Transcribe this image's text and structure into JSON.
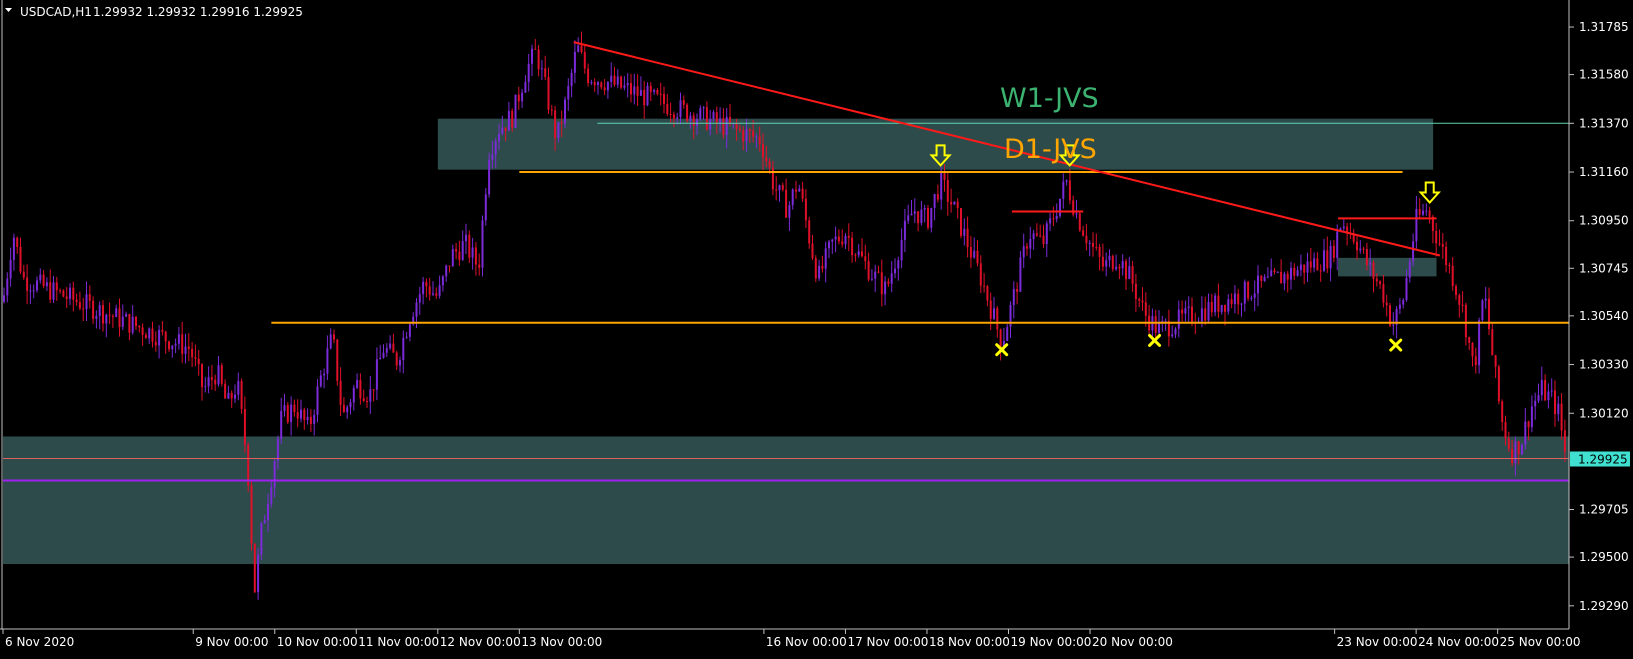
{
  "header": {
    "symbol_label": "USDCAD,H1",
    "ohlc_text": "1.29932 1.29932 1.29916 1.29925"
  },
  "colors": {
    "background": "#000000",
    "axis": "#c0c0c0",
    "bull_candle": "#7b2bd9",
    "bear_candle": "#e0102a",
    "zone_fill": "#2f4f4f",
    "orange_line": "#ffa500",
    "trend_line": "#ff1a1a",
    "w1_line": "#5fd3b0",
    "purple_line": "#a020f0",
    "marker": "#ffff00",
    "price_box": "#40e0d0"
  },
  "annotations": {
    "w1_label": "W1-JVS",
    "d1_label": "D1-JVS"
  },
  "chart_data": {
    "type": "candlestick",
    "symbol": "USDCAD",
    "timeframe": "H1",
    "ylim": [
      1.2919,
      1.3188
    ],
    "xlim": [
      "2020-11-06T16:00",
      "2020-11-25T21:00"
    ],
    "y_ticks": [
      "1.31785",
      "1.31580",
      "1.31370",
      "1.31160",
      "1.30950",
      "1.30745",
      "1.30540",
      "1.30330",
      "1.30120",
      "1.29705",
      "1.29500",
      "1.29290"
    ],
    "x_ticks": [
      {
        "label": "6 Nov 2020",
        "t": "2020-11-06T16:00"
      },
      {
        "label": "9 Nov 00:00",
        "t": "2020-11-09T00:00"
      },
      {
        "label": "10 Nov 00:00",
        "t": "2020-11-10T00:00"
      },
      {
        "label": "11 Nov 00:00",
        "t": "2020-11-11T00:00"
      },
      {
        "label": "12 Nov 00:00",
        "t": "2020-11-12T00:00"
      },
      {
        "label": "13 Nov 00:00",
        "t": "2020-11-13T00:00"
      },
      {
        "label": "16 Nov 00:00",
        "t": "2020-11-16T00:00"
      },
      {
        "label": "17 Nov 00:00",
        "t": "2020-11-17T00:00"
      },
      {
        "label": "18 Nov 00:00",
        "t": "2020-11-18T00:00"
      },
      {
        "label": "19 Nov 00:00",
        "t": "2020-11-19T00:00"
      },
      {
        "label": "20 Nov 00:00",
        "t": "2020-11-20T00:00"
      },
      {
        "label": "23 Nov 00:00",
        "t": "2020-11-23T00:00"
      },
      {
        "label": "24 Nov 00:00",
        "t": "2020-11-24T00:00"
      },
      {
        "label": "25 Nov 00:00",
        "t": "2020-11-25T00:00"
      }
    ],
    "current_price": "1.29925",
    "price_path": [
      [
        "2020-11-06T16:00",
        1.306
      ],
      [
        "2020-11-06T19:00",
        1.309
      ],
      [
        "2020-11-06T22:00",
        1.307
      ],
      [
        "2020-11-08T23:00",
        1.304
      ],
      [
        "2020-11-09T03:00",
        1.3022
      ],
      [
        "2020-11-09T07:00",
        1.303
      ],
      [
        "2020-11-09T10:00",
        1.3015
      ],
      [
        "2020-11-09T13:00",
        1.3025
      ],
      [
        "2020-11-09T16:00",
        1.299
      ],
      [
        "2020-11-09T18:00",
        1.2935
      ],
      [
        "2020-11-09T20:00",
        1.296
      ],
      [
        "2020-11-09T23:00",
        1.2985
      ],
      [
        "2020-11-10T02:00",
        1.301
      ],
      [
        "2020-11-10T06:00",
        1.3015
      ],
      [
        "2020-11-10T10:00",
        1.3005
      ],
      [
        "2020-11-10T14:00",
        1.303
      ],
      [
        "2020-11-10T17:00",
        1.3045
      ],
      [
        "2020-11-10T20:00",
        1.301
      ],
      [
        "2020-11-11T00:00",
        1.3025
      ],
      [
        "2020-11-11T04:00",
        1.302
      ],
      [
        "2020-11-11T08:00",
        1.304
      ],
      [
        "2020-11-11T12:00",
        1.3035
      ],
      [
        "2020-11-11T16:00",
        1.3055
      ],
      [
        "2020-11-11T20:00",
        1.3068
      ],
      [
        "2020-11-12T00:00",
        1.3062
      ],
      [
        "2020-11-12T04:00",
        1.308
      ],
      [
        "2020-11-12T08:00",
        1.3085
      ],
      [
        "2020-11-12T12:00",
        1.3075
      ],
      [
        "2020-11-12T15:00",
        1.3125
      ],
      [
        "2020-11-12T18:00",
        1.3135
      ],
      [
        "2020-11-12T22:00",
        1.314
      ],
      [
        "2020-11-13T02:00",
        1.316
      ],
      [
        "2020-11-13T05:00",
        1.3168
      ],
      [
        "2020-11-13T08:00",
        1.315
      ],
      [
        "2020-11-13T11:00",
        1.313
      ],
      [
        "2020-11-13T14:00",
        1.3148
      ],
      [
        "2020-11-13T17:00",
        1.317
      ],
      [
        "2020-11-13T20:00",
        1.3158
      ],
      [
        "2020-11-15T23:00",
        1.313
      ],
      [
        "2020-11-16T03:00",
        1.311
      ],
      [
        "2020-11-16T07:00",
        1.31
      ],
      [
        "2020-11-16T10:00",
        1.3112
      ],
      [
        "2020-11-16T13:00",
        1.309
      ],
      [
        "2020-11-16T16:00",
        1.307
      ],
      [
        "2020-11-16T20:00",
        1.3085
      ],
      [
        "2020-11-17T00:00",
        1.309
      ],
      [
        "2020-11-17T04:00",
        1.308
      ],
      [
        "2020-11-17T08:00",
        1.3072
      ],
      [
        "2020-11-17T12:00",
        1.3065
      ],
      [
        "2020-11-17T16:00",
        1.3085
      ],
      [
        "2020-11-17T20:00",
        1.31
      ],
      [
        "2020-11-18T00:00",
        1.3095
      ],
      [
        "2020-11-18T04:00",
        1.3112
      ],
      [
        "2020-11-18T08:00",
        1.31
      ],
      [
        "2020-11-18T12:00",
        1.3085
      ],
      [
        "2020-11-18T16:00",
        1.307
      ],
      [
        "2020-11-18T20:00",
        1.3052
      ],
      [
        "2020-11-18T22:00",
        1.3042
      ],
      [
        "2020-11-19T02:00",
        1.3065
      ],
      [
        "2020-11-19T06:00",
        1.309
      ],
      [
        "2020-11-19T10:00",
        1.3085
      ],
      [
        "2020-11-19T14:00",
        1.31
      ],
      [
        "2020-11-19T17:00",
        1.3112
      ],
      [
        "2020-11-19T20:00",
        1.3098
      ],
      [
        "2020-11-20T00:00",
        1.3085
      ],
      [
        "2020-11-20T04:00",
        1.3075
      ],
      [
        "2020-11-20T08:00",
        1.308
      ],
      [
        "2020-11-20T12:00",
        1.307
      ],
      [
        "2020-11-20T16:00",
        1.3055
      ],
      [
        "2020-11-20T20:00",
        1.3048
      ],
      [
        "2020-11-22T23:00",
        1.308
      ],
      [
        "2020-11-23T02:00",
        1.3095
      ],
      [
        "2020-11-23T06:00",
        1.3088
      ],
      [
        "2020-11-23T10:00",
        1.3075
      ],
      [
        "2020-11-23T14:00",
        1.3065
      ],
      [
        "2020-11-23T17:00",
        1.305
      ],
      [
        "2020-11-23T20:00",
        1.306
      ],
      [
        "2020-11-24T00:00",
        1.3095
      ],
      [
        "2020-11-24T03:00",
        1.31
      ],
      [
        "2020-11-24T07:00",
        1.3085
      ],
      [
        "2020-11-24T11:00",
        1.307
      ],
      [
        "2020-11-24T14:00",
        1.3055
      ],
      [
        "2020-11-24T17:00",
        1.303
      ],
      [
        "2020-11-24T20:00",
        1.3065
      ],
      [
        "2020-11-24T22:00",
        1.3042
      ],
      [
        "2020-11-25T01:00",
        1.301
      ],
      [
        "2020-11-25T04:00",
        1.2995
      ],
      [
        "2020-11-25T07:00",
        1.3
      ],
      [
        "2020-11-25T10:00",
        1.3015
      ],
      [
        "2020-11-25T13:00",
        1.3022
      ],
      [
        "2020-11-25T16:00",
        1.3018
      ],
      [
        "2020-11-25T18:00",
        1.3012
      ],
      [
        "2020-11-25T20:00",
        1.29932
      ]
    ],
    "zones": [
      {
        "name": "W1-JVS",
        "t0": "2020-11-12T00:00",
        "t1": "2020-11-24T05:00",
        "y0": 1.3117,
        "y1": 1.3139
      },
      {
        "name": "mid-zone",
        "t0": "2020-11-23T01:00",
        "t1": "2020-11-24T06:00",
        "y0": 1.3071,
        "y1": 1.3079
      },
      {
        "name": "bottom-zone",
        "t0": "2020-11-06T16:00",
        "t1": "2020-11-25T21:00",
        "y0": 1.2947,
        "y1": 1.3002
      }
    ],
    "levels": [
      {
        "name": "w1-line",
        "price": 1.3137,
        "t0": "2020-11-13T23:00"
      },
      {
        "name": "d1-line",
        "price": 1.3116,
        "t0": "2020-11-13T00:00",
        "t1": "2020-11-23T20:00"
      },
      {
        "name": "support-line",
        "price": 1.3051,
        "t0": "2020-11-09T23:00"
      },
      {
        "name": "purple-line",
        "price": 1.2983
      },
      {
        "name": "price-line",
        "price": 1.29925
      },
      {
        "name": "resistance-19nov",
        "price": 1.3099,
        "t0": "2020-11-19T01:00",
        "t1": "2020-11-19T22:00"
      },
      {
        "name": "resistance-23nov",
        "price": 1.3096,
        "t0": "2020-11-23T01:00",
        "t1": "2020-11-24T06:00"
      }
    ],
    "trendline": {
      "p0": [
        "2020-11-13T16:00",
        1.3172
      ],
      "p1": [
        "2020-11-24T07:00",
        1.308
      ]
    },
    "arrows": [
      {
        "t": "2020-11-18T04:00",
        "price": 1.3118
      },
      {
        "t": "2020-11-19T18:00",
        "price": 1.3118
      },
      {
        "t": "2020-11-24T04:00",
        "price": 1.3102
      }
    ],
    "crosses": [
      {
        "t": "2020-11-18T22:00",
        "price": 1.3042
      },
      {
        "t": "2020-11-20T19:00",
        "price": 1.3046
      },
      {
        "t": "2020-11-23T18:00",
        "price": 1.3044
      }
    ]
  }
}
